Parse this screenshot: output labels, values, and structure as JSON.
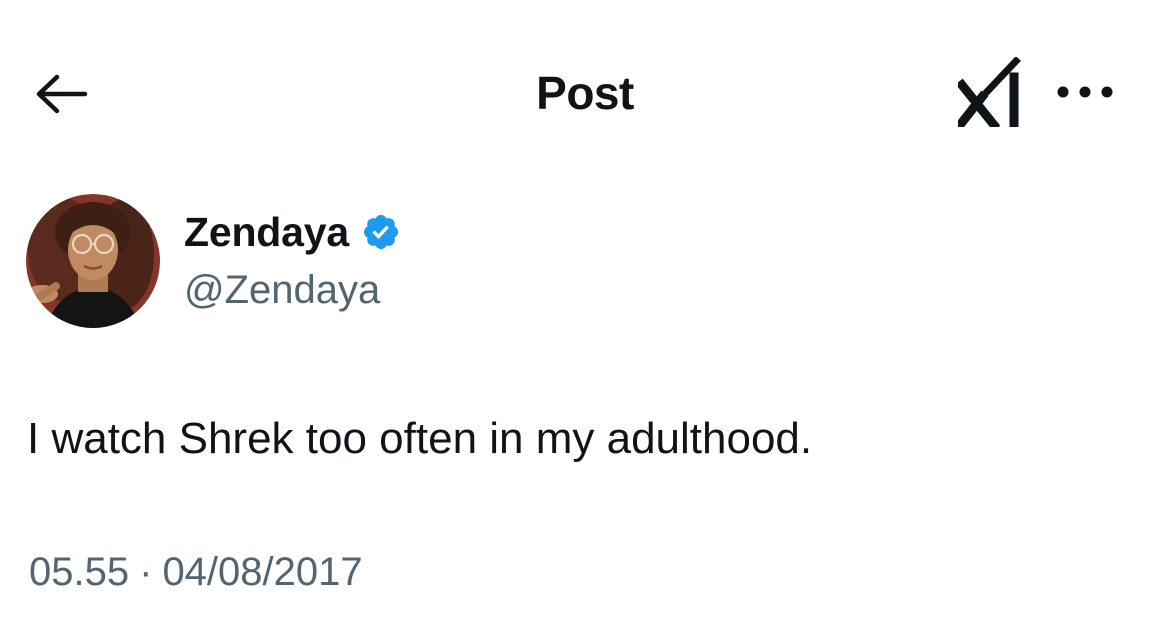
{
  "header": {
    "title": "Post",
    "back_icon": "arrow-left-icon",
    "grok_icon": "grok-icon",
    "more_icon": "more-horizontal-icon"
  },
  "author": {
    "display_name": "Zendaya",
    "handle": "@Zendaya",
    "verified": true,
    "verified_color": "#1d9bf0"
  },
  "post": {
    "text": "I watch Shrek too often in my adulthood.",
    "time": "05.55",
    "separator": "·",
    "date": "04/08/2017"
  },
  "colors": {
    "text_primary": "#0f1419",
    "text_secondary": "#536471",
    "background": "#ffffff"
  }
}
